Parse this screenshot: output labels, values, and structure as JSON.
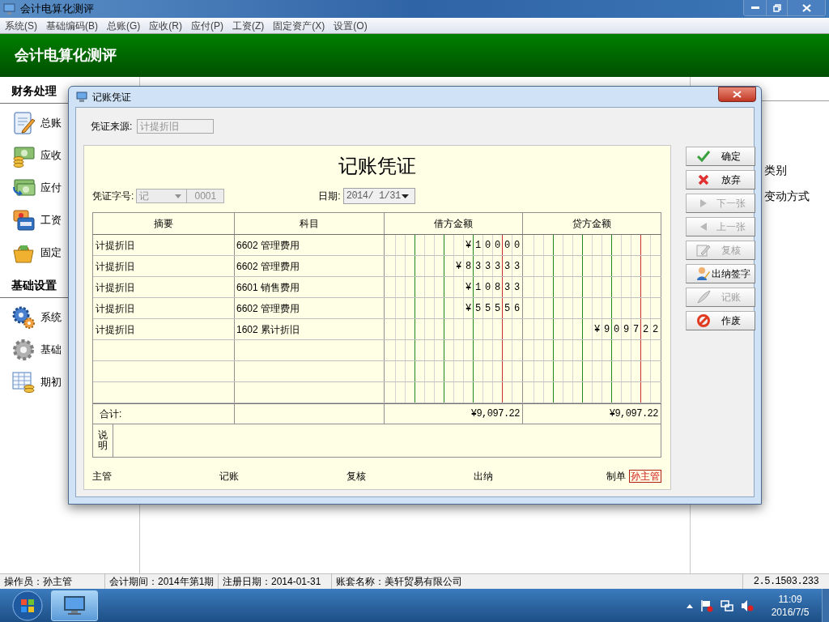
{
  "window": {
    "title": "会计电算化测评"
  },
  "menu": [
    "系统(S)",
    "基础编码(B)",
    "总账(G)",
    "应收(R)",
    "应付(P)",
    "工资(Z)",
    "固定资产(X)",
    "设置(O)"
  ],
  "banner": {
    "title": "会计电算化测评"
  },
  "sidebar": {
    "sections": [
      {
        "title": "财务处理",
        "items": [
          "总账",
          "应收",
          "应付",
          "工资",
          "固定"
        ]
      },
      {
        "title": "基础设置",
        "items": [
          "系统",
          "基础",
          "期初"
        ]
      }
    ]
  },
  "right_panel": {
    "items": [
      "类别",
      "变动方式"
    ]
  },
  "dialog": {
    "title": "记账凭证",
    "source": {
      "label": "凭证来源:",
      "value": "计提折旧"
    },
    "voucher_title": "记账凭证",
    "voucher_no": {
      "label": "凭证字号:",
      "type": "记",
      "number": "0001"
    },
    "date": {
      "label": "日期:",
      "value": "2014/ 1/31"
    },
    "table": {
      "columns": [
        "摘要",
        "科目",
        "借方金额",
        "贷方金额"
      ],
      "rows": [
        {
          "summary": "计提折旧",
          "account": "6602 管理费用",
          "debit": "¥10000"
        },
        {
          "summary": "计提折旧",
          "account": "6602 管理费用",
          "debit": "¥833333"
        },
        {
          "summary": "计提折旧",
          "account": "6601 销售费用",
          "debit": "¥10833"
        },
        {
          "summary": "计提折旧",
          "account": "6602 管理费用",
          "debit": "¥55556"
        },
        {
          "summary": "计提折旧",
          "account": "1602 累计折旧",
          "credit": "¥909722"
        }
      ],
      "totals": {
        "label": "合计:",
        "debit": "¥9,097.22",
        "credit": "¥9,097.22"
      },
      "note_label": "说明"
    },
    "signatures": [
      {
        "label": "主管"
      },
      {
        "label": "记账"
      },
      {
        "label": "复核"
      },
      {
        "label": "出纳"
      },
      {
        "label": "制单",
        "signer": "孙主管"
      }
    ],
    "buttons": [
      {
        "label": "确定",
        "disabled": false
      },
      {
        "label": "放弃",
        "disabled": false
      },
      {
        "label": "下一张",
        "disabled": true
      },
      {
        "label": "上一张",
        "disabled": true
      },
      {
        "label": "复核",
        "disabled": true
      },
      {
        "label": "出纳签字",
        "disabled": false
      },
      {
        "label": "记账",
        "disabled": true
      },
      {
        "label": "作废",
        "disabled": false
      }
    ]
  },
  "status_bar": {
    "fields": [
      "操作员：孙主管",
      "会计期间：2014年第1期",
      "注册日期：2014-01-31",
      "账套名称：美轩贸易有限公司"
    ],
    "version": "2.5.1503.233"
  },
  "taskbar": {
    "time": "11:09",
    "date": "2016/7/5"
  }
}
